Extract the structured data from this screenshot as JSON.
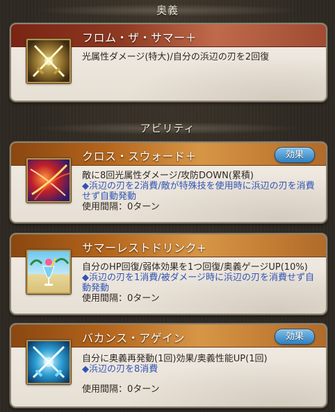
{
  "sections": {
    "ougi_title": "奥義",
    "ability_title": "アビリティ"
  },
  "ougi": {
    "name": "フロム・ザ・サマー＋",
    "desc": "光属性ダメージ(特大)/自分の浜辺の刃を2回復",
    "icon": "crossed-swords-icon"
  },
  "abilities": [
    {
      "name": "クロス・スウォード＋",
      "effect_label": "効果",
      "desc": "敵に8回光属性ダメージ/攻防DOWN(累積)",
      "note": "◆浜辺の刃を2消費/敵が特殊技を使用時に浜辺の刃を消費せず自動発動",
      "cooldown": "使用間隔：0ターン",
      "icon": "cross-slash-icon"
    },
    {
      "name": "サマーレストドリンク+",
      "desc": "自分のHP回復/弱体効果を1つ回復/奥義ゲージUP(10%)",
      "note": "◆浜辺の刃を1消費/被ダメージ時に浜辺の刃を消費せず自動発動",
      "cooldown": "使用間隔：0ターン",
      "icon": "tropical-drink-icon"
    },
    {
      "name": "バカンス・アゲイン",
      "effect_label": "効果",
      "desc": "自分に奥義再発動(1回)効果/奥義性能UP(1回)",
      "note": "◆浜辺の刃を8消費",
      "cooldown": "使用間隔：0ターン",
      "icon": "glowing-swords-icon"
    }
  ]
}
